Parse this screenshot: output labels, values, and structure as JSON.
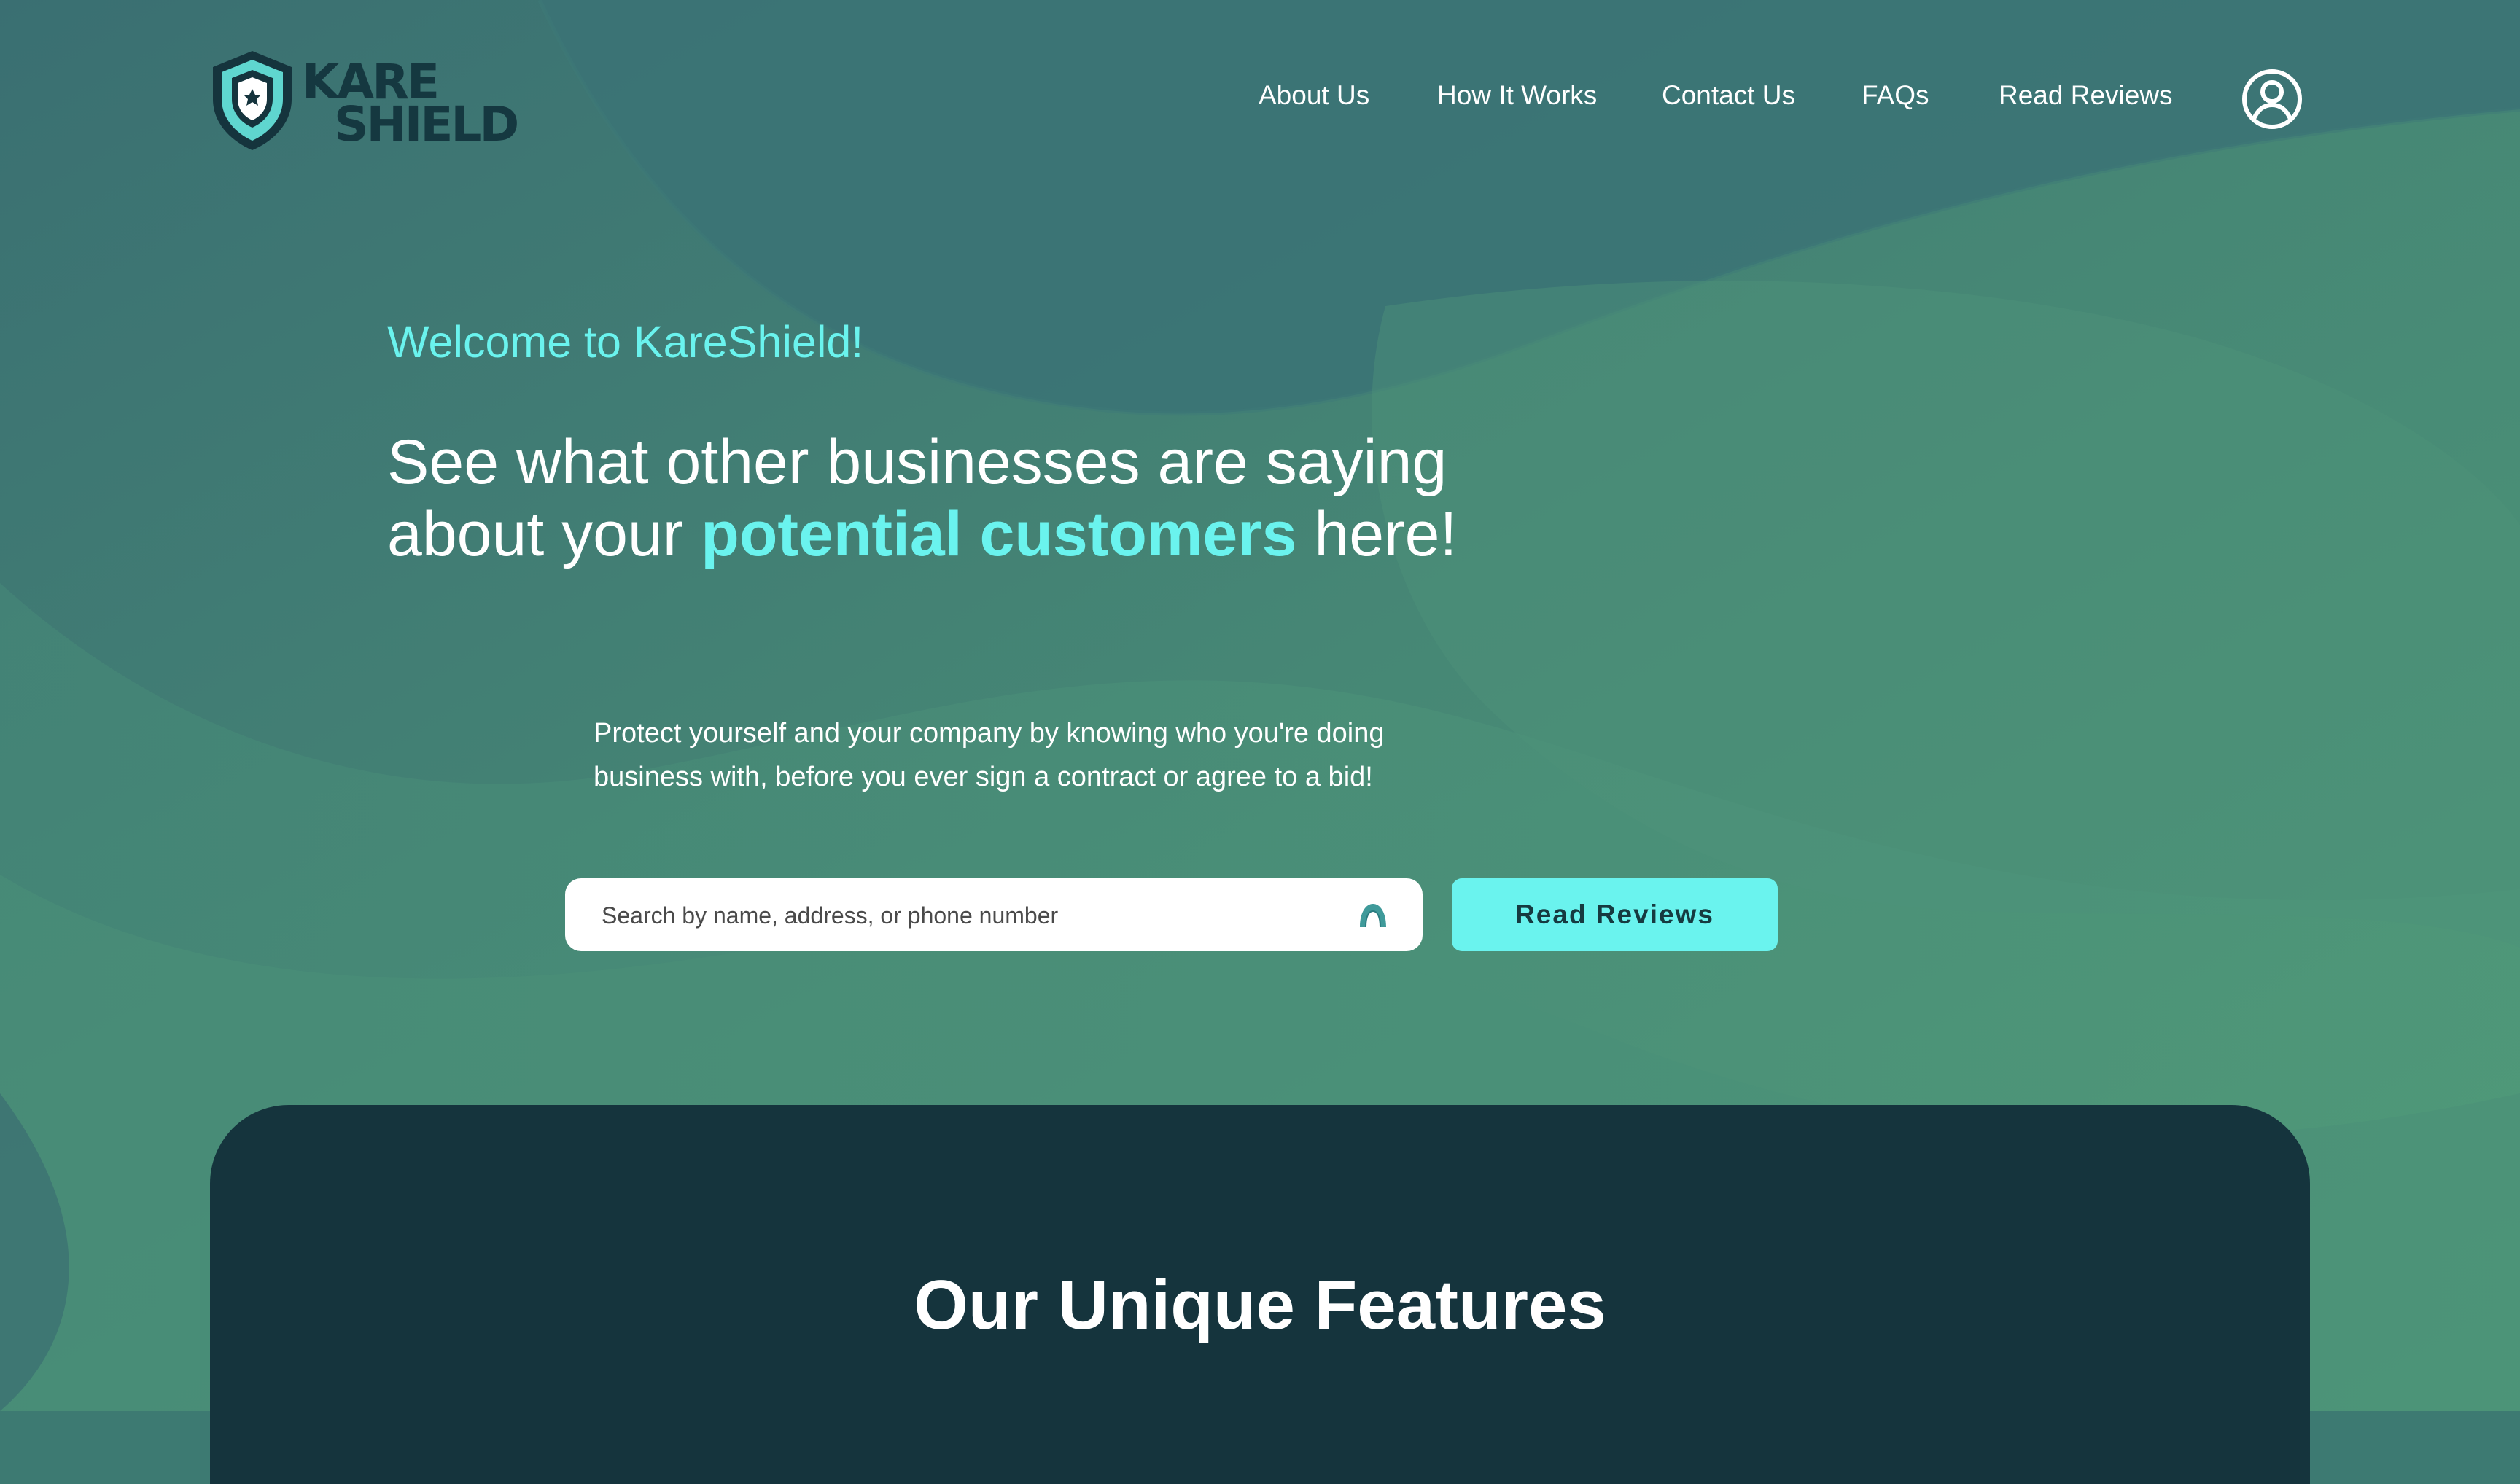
{
  "brand": {
    "name_line1": "KARE",
    "name_line2": "SHIELD",
    "logo_icon": "shield-icon"
  },
  "nav": {
    "items": [
      {
        "label": "About Us"
      },
      {
        "label": "How It Works"
      },
      {
        "label": "Contact Us"
      },
      {
        "label": "FAQs"
      },
      {
        "label": "Read Reviews"
      }
    ],
    "account_icon": "user-account-icon"
  },
  "hero": {
    "welcome": "Welcome to KareShield!",
    "headline_part1": "See what other businesses are saying about your ",
    "headline_accent": "potential customers",
    "headline_part2": " here!",
    "description": "Protect yourself and your company by knowing who you're doing business with, before you ever sign a contract or agree to a bid!"
  },
  "search": {
    "placeholder": "Search by name, address, or phone number",
    "value": "",
    "icon": "search-icon",
    "button_label": "Read Reviews"
  },
  "features": {
    "title": "Our Unique Features"
  },
  "colors": {
    "background": "#3d7a72",
    "accent": "#6af3ee",
    "dark_panel": "#15343d",
    "logo_text": "#153840",
    "white": "#ffffff"
  }
}
